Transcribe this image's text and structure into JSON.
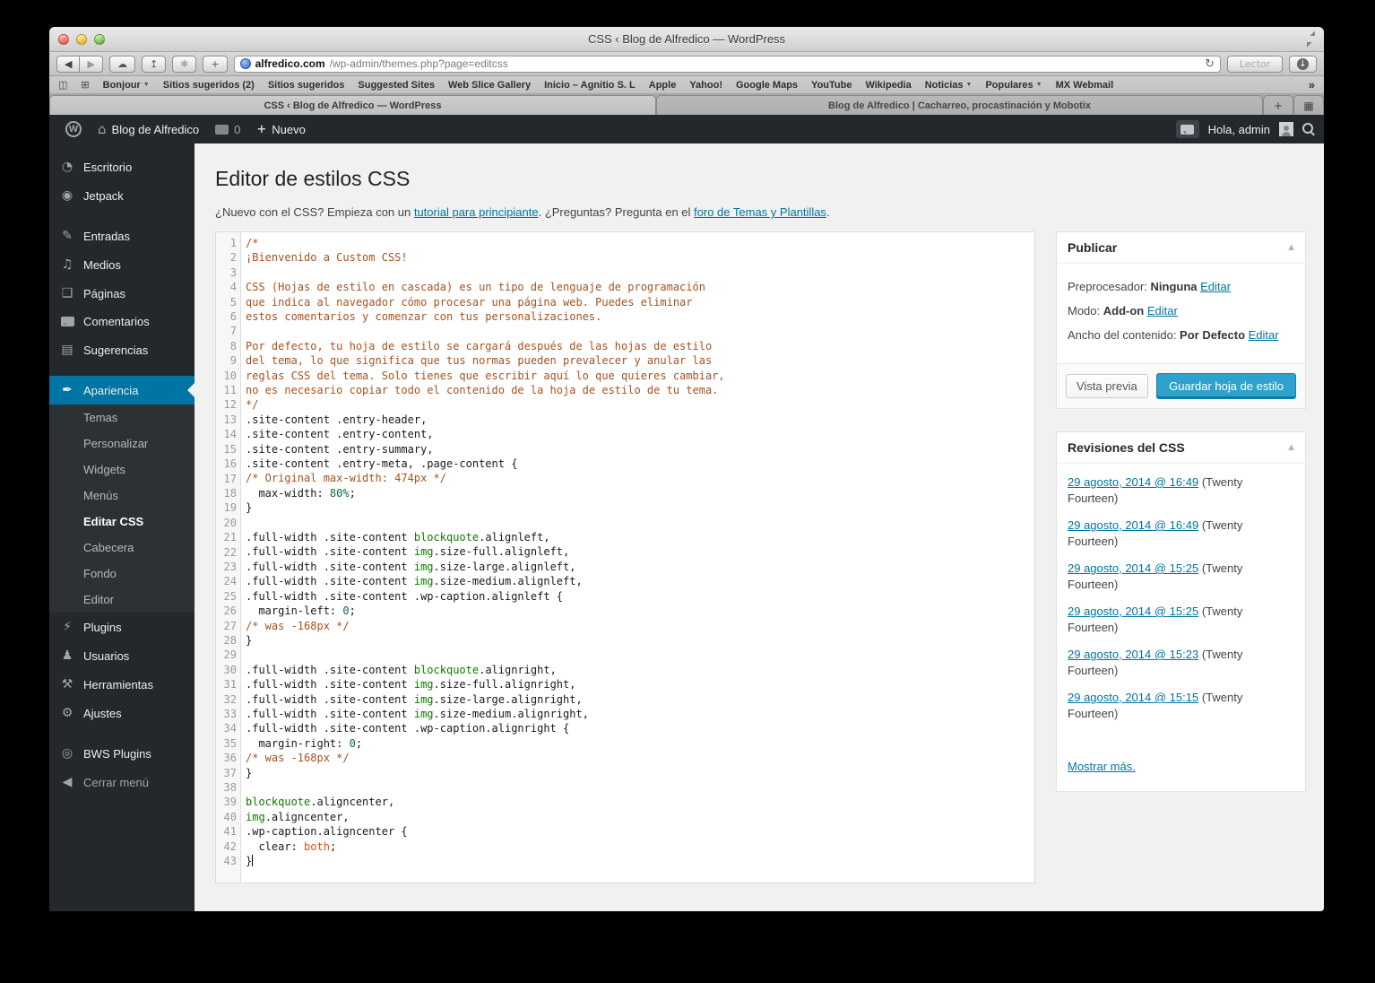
{
  "colors": {
    "accent_blue": "#0074a2",
    "primary_button": "#2ea2cc",
    "admin_dark": "#23282d",
    "content_bg": "#f1f1f1",
    "comment_token": "#a5521f",
    "tag_token": "#117700",
    "keyword_token": "#dd4f1e"
  },
  "icons": {
    "back": "◀",
    "forward": "▶",
    "cloud": "☁",
    "share": "↥",
    "top_sites": "✱",
    "add_tab": "+",
    "reload": "↻",
    "download": "↓",
    "book": "◫",
    "grid": "⊞",
    "home": "⌂",
    "wp": "W",
    "plus": "+",
    "panel_collapse": "▲",
    "bookmarks_overflow": "»",
    "tabs_overview": "▦",
    "menu_caret": "▼"
  },
  "browser": {
    "window_title": "CSS ‹ Blog de Alfredico — WordPress",
    "url_host": "alfredico.com",
    "url_path": "/wp-admin/themes.php?page=editcss",
    "reader_button": "Lector",
    "bookmarks": [
      {
        "label": "Bonjour",
        "menu": true
      },
      {
        "label": "Sitios sugeridos (2)",
        "menu": false
      },
      {
        "label": "Sitios sugeridos",
        "menu": false
      },
      {
        "label": "Suggested Sites",
        "menu": false
      },
      {
        "label": "Web Slice Gallery",
        "menu": false
      },
      {
        "label": "Inicio – Agnitio S. L",
        "menu": false
      },
      {
        "label": "Apple",
        "menu": false
      },
      {
        "label": "Yahoo!",
        "menu": false
      },
      {
        "label": "Google Maps",
        "menu": false
      },
      {
        "label": "YouTube",
        "menu": false
      },
      {
        "label": "Wikipedia",
        "menu": false
      },
      {
        "label": "Noticias",
        "menu": true
      },
      {
        "label": "Populares",
        "menu": true
      },
      {
        "label": "MX Webmail",
        "menu": false
      }
    ],
    "tabs": [
      {
        "title": "CSS ‹ Blog de Alfredico — WordPress",
        "active": true
      },
      {
        "title": "Blog de Alfredico | Cacharreo, procastinación y Mobotix",
        "active": false
      }
    ]
  },
  "admin_bar": {
    "site_name": "Blog de Alfredico",
    "comments_count": "0",
    "new_label": "Nuevo",
    "greeting": "Hola, admin"
  },
  "sidebar": {
    "items": [
      {
        "label": "Escritorio",
        "icon": "dashboard-icon",
        "glyph": "◔",
        "kind": "top",
        "state": "normal",
        "gap": false
      },
      {
        "label": "Jetpack",
        "icon": "jetpack-icon",
        "glyph": "◉",
        "kind": "top",
        "state": "normal",
        "gap": false
      },
      {
        "label": "Entradas",
        "icon": "pushpin-icon",
        "glyph": "✎",
        "kind": "top",
        "state": "normal",
        "gap": true
      },
      {
        "label": "Medios",
        "icon": "media-icon",
        "glyph": "♫",
        "kind": "top",
        "state": "normal",
        "gap": false
      },
      {
        "label": "Páginas",
        "icon": "pages-icon",
        "glyph": "❏",
        "kind": "top",
        "state": "normal",
        "gap": false
      },
      {
        "label": "Comentarios",
        "icon": "comments-icon",
        "glyph": "",
        "kind": "top",
        "state": "normal",
        "gap": false
      },
      {
        "label": "Sugerencias",
        "icon": "feedback-icon",
        "glyph": "▤",
        "kind": "top",
        "state": "normal",
        "gap": false
      },
      {
        "label": "Apariencia",
        "icon": "brush-icon",
        "glyph": "✒",
        "kind": "top",
        "state": "active",
        "gap": true
      },
      {
        "label": "Temas",
        "icon": "",
        "glyph": "",
        "kind": "sub",
        "state": "normal",
        "gap": false
      },
      {
        "label": "Personalizar",
        "icon": "",
        "glyph": "",
        "kind": "sub",
        "state": "normal",
        "gap": false
      },
      {
        "label": "Widgets",
        "icon": "",
        "glyph": "",
        "kind": "sub",
        "state": "normal",
        "gap": false
      },
      {
        "label": "Menús",
        "icon": "",
        "glyph": "",
        "kind": "sub",
        "state": "normal",
        "gap": false
      },
      {
        "label": "Editar CSS",
        "icon": "",
        "glyph": "",
        "kind": "sub",
        "state": "current",
        "gap": false
      },
      {
        "label": "Cabecera",
        "icon": "",
        "glyph": "",
        "kind": "sub",
        "state": "normal",
        "gap": false
      },
      {
        "label": "Fondo",
        "icon": "",
        "glyph": "",
        "kind": "sub",
        "state": "normal",
        "gap": false
      },
      {
        "label": "Editor",
        "icon": "",
        "glyph": "",
        "kind": "sub",
        "state": "normal",
        "gap": false
      },
      {
        "label": "Plugins",
        "icon": "plugin-icon",
        "glyph": "⚡",
        "kind": "top",
        "state": "normal",
        "gap": false
      },
      {
        "label": "Usuarios",
        "icon": "user-icon",
        "glyph": "♟",
        "kind": "top",
        "state": "normal",
        "gap": false
      },
      {
        "label": "Herramientas",
        "icon": "tools-icon",
        "glyph": "⚒",
        "kind": "top",
        "state": "normal",
        "gap": false
      },
      {
        "label": "Ajustes",
        "icon": "settings-icon",
        "glyph": "⚙",
        "kind": "top",
        "state": "normal",
        "gap": false
      },
      {
        "label": "BWS Plugins",
        "icon": "bws-plugins-icon",
        "glyph": "◎",
        "kind": "top",
        "state": "normal",
        "gap": true
      },
      {
        "label": "Cerrar menú",
        "icon": "collapse-menu-icon",
        "glyph": "◀",
        "kind": "top",
        "state": "dim",
        "gap": false
      }
    ]
  },
  "page": {
    "title": "Editor de estilos CSS",
    "intro": [
      {
        "t": "text",
        "v": "¿Nuevo con el CSS? Empieza con un "
      },
      {
        "t": "link",
        "v": "tutorial para principiante"
      },
      {
        "t": "text",
        "v": ". ¿Preguntas? Pregunta en el "
      },
      {
        "t": "link",
        "v": "foro de Temas y Plantillas"
      },
      {
        "t": "text",
        "v": "."
      }
    ]
  },
  "editor": {
    "cursor_line": 43,
    "lines": [
      [
        [
          "c",
          "/*"
        ]
      ],
      [
        [
          "c",
          "¡Bienvenido a Custom CSS!"
        ]
      ],
      [],
      [
        [
          "c",
          "CSS (Hojas de estilo en cascada) es un tipo de lenguaje de programación"
        ]
      ],
      [
        [
          "c",
          "que indica al navegador cómo procesar una página web. Puedes eliminar"
        ]
      ],
      [
        [
          "c",
          "estos comentarios y comenzar con tus personalizaciones."
        ]
      ],
      [],
      [
        [
          "c",
          "Por defecto, tu hoja de estilo se cargará después de las hojas de estilo"
        ]
      ],
      [
        [
          "c",
          "del tema, lo que significa que tus normas pueden prevalecer y anular las"
        ]
      ],
      [
        [
          "c",
          "reglas CSS del tema. Solo tienes que escribir aquí lo que quieres cambiar,"
        ]
      ],
      [
        [
          "c",
          "no es necesario copiar todo el contenido de la hoja de estilo de tu tema."
        ]
      ],
      [
        [
          "c",
          "*/"
        ]
      ],
      [
        [
          "p",
          ".site-content .entry-header,"
        ]
      ],
      [
        [
          "p",
          ".site-content .entry-content,"
        ]
      ],
      [
        [
          "p",
          ".site-content .entry-summary,"
        ]
      ],
      [
        [
          "p",
          ".site-content .entry-meta, .page-content {"
        ]
      ],
      [
        [
          "c",
          "/* Original max-width: 474px */"
        ]
      ],
      [
        [
          "p",
          "  max-width: "
        ],
        [
          "n",
          "80%"
        ],
        [
          "p",
          ";"
        ]
      ],
      [
        [
          "p",
          "}"
        ]
      ],
      [],
      [
        [
          "p",
          ".full-width .site-content "
        ],
        [
          "t",
          "blockquote"
        ],
        [
          "p",
          ".alignleft,"
        ]
      ],
      [
        [
          "p",
          ".full-width .site-content "
        ],
        [
          "t",
          "img"
        ],
        [
          "p",
          ".size-full.alignleft,"
        ]
      ],
      [
        [
          "p",
          ".full-width .site-content "
        ],
        [
          "t",
          "img"
        ],
        [
          "p",
          ".size-large.alignleft,"
        ]
      ],
      [
        [
          "p",
          ".full-width .site-content "
        ],
        [
          "t",
          "img"
        ],
        [
          "p",
          ".size-medium.alignleft,"
        ]
      ],
      [
        [
          "p",
          ".full-width .site-content .wp-caption.alignleft {"
        ]
      ],
      [
        [
          "p",
          "  margin-left: "
        ],
        [
          "n",
          "0"
        ],
        [
          "p",
          ";"
        ]
      ],
      [
        [
          "c",
          "/* was -168px */"
        ]
      ],
      [
        [
          "p",
          "}"
        ]
      ],
      [],
      [
        [
          "p",
          ".full-width .site-content "
        ],
        [
          "t",
          "blockquote"
        ],
        [
          "p",
          ".alignright,"
        ]
      ],
      [
        [
          "p",
          ".full-width .site-content "
        ],
        [
          "t",
          "img"
        ],
        [
          "p",
          ".size-full.alignright,"
        ]
      ],
      [
        [
          "p",
          ".full-width .site-content "
        ],
        [
          "t",
          "img"
        ],
        [
          "p",
          ".size-large.alignright,"
        ]
      ],
      [
        [
          "p",
          ".full-width .site-content "
        ],
        [
          "t",
          "img"
        ],
        [
          "p",
          ".size-medium.alignright,"
        ]
      ],
      [
        [
          "p",
          ".full-width .site-content .wp-caption.alignright {"
        ]
      ],
      [
        [
          "p",
          "  margin-right: "
        ],
        [
          "n",
          "0"
        ],
        [
          "p",
          ";"
        ]
      ],
      [
        [
          "c",
          "/* was -168px */"
        ]
      ],
      [
        [
          "p",
          "}"
        ]
      ],
      [],
      [
        [
          "t",
          "blockquote"
        ],
        [
          "p",
          ".aligncenter,"
        ]
      ],
      [
        [
          "t",
          "img"
        ],
        [
          "p",
          ".aligncenter,"
        ]
      ],
      [
        [
          "p",
          ".wp-caption.aligncenter {"
        ]
      ],
      [
        [
          "p",
          "  clear: "
        ],
        [
          "k",
          "both"
        ],
        [
          "p",
          ";"
        ]
      ],
      [
        [
          "p",
          "}"
        ]
      ]
    ]
  },
  "publish_panel": {
    "title": "Publicar",
    "rows": [
      {
        "label": "Preprocesador:",
        "value": "Ninguna",
        "action": "Editar"
      },
      {
        "label": "Modo:",
        "value": "Add-on",
        "action": "Editar"
      },
      {
        "label": "Ancho del contenido:",
        "value": "Por Defecto",
        "action": "Editar"
      }
    ],
    "preview_button": "Vista previa",
    "save_button": "Guardar hoja de estilo"
  },
  "revisions_panel": {
    "title": "Revisiones del CSS",
    "items": [
      {
        "link": "29 agosto, 2014 @ 16:49",
        "suffix": " (Twenty Fourteen)"
      },
      {
        "link": "29 agosto, 2014 @ 16:49",
        "suffix": " (Twenty Fourteen)"
      },
      {
        "link": "29 agosto, 2014 @ 15:25",
        "suffix": " (Twenty Fourteen)"
      },
      {
        "link": "29 agosto, 2014 @ 15:25",
        "suffix": " (Twenty Fourteen)"
      },
      {
        "link": "29 agosto, 2014 @ 15:23",
        "suffix": " (Twenty Fourteen)"
      },
      {
        "link": "29 agosto, 2014 @ 15:15",
        "suffix": " (Twenty Fourteen)"
      }
    ],
    "more_link": "Mostrar más."
  }
}
